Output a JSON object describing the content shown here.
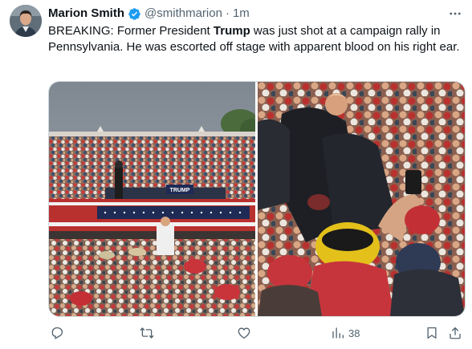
{
  "author": {
    "name": "Marion Smith",
    "handle": "@smithmarion",
    "separator": "·",
    "time": "1m",
    "verified": true
  },
  "tweet": {
    "text_prefix": "BREAKING: Former President ",
    "text_bold": "Trump",
    "text_suffix": " was just shot at a campaign rally in Pennsylvania. He was escorted off stage with apparent blood on his right ear."
  },
  "media": {
    "left_image": "rally-stage-crowd-photo",
    "right_image": "trump-escorted-crowd-photo",
    "sign_text": "TRUMP"
  },
  "actions": {
    "views_count": "38"
  },
  "icons": {
    "more": "more-icon",
    "reply": "reply-icon",
    "retweet": "retweet-icon",
    "like": "like-icon",
    "views": "views-icon",
    "bookmark": "bookmark-icon",
    "share": "share-icon",
    "verified": "verified-badge-icon"
  },
  "colors": {
    "text": "#0f1419",
    "secondary": "#536471",
    "verified": "#1d9bf0",
    "border": "#cfd9de"
  }
}
